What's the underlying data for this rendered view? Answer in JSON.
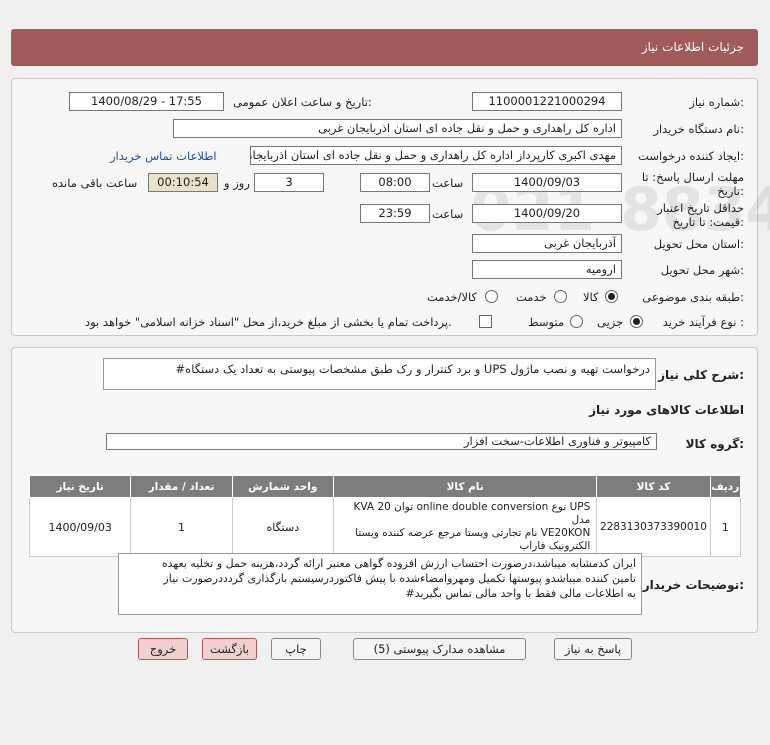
{
  "header": {
    "title": "جزئیات اطلاعات نیاز"
  },
  "form": {
    "need_number_label": "شماره نیاز:",
    "need_number": "1100001221000294",
    "announce_label": "تاریخ و ساعت اعلان عمومی:",
    "announce_value": "1400/08/29 - 17:55",
    "buyer_label": "نام دستگاه خریدار:",
    "buyer_value": "اداره کل راهداری و حمل و نقل جاده ای استان اذربایجان غربی",
    "requester_label": "ایجاد کننده درخواست:",
    "requester_value": "مهدی اکبری کارپرداز اداره کل راهداری و حمل و نقل جاده ای استان اذربایجان غ",
    "contact_link": "اطلاعات تماس خریدار",
    "deadline_label_1": "مهلت ارسال پاسخ: تا",
    "deadline_label_2": "تاریخ:",
    "deadline_date": "1400/09/03",
    "time_label": "ساعت",
    "deadline_time": "08:00",
    "days_value": "3",
    "days_label": "روز و",
    "remaining_time": "00:10:54",
    "remaining_label": "ساعت باقی مانده",
    "validity_label_1": "حداقل تاریخ اعتبار",
    "validity_label_2": "قیمت: تا تاریخ:",
    "validity_date": "1400/09/20",
    "validity_time_label": "ساعت",
    "validity_time": "23:59",
    "province_label": "استان محل تحویل:",
    "province_value": "آذربایجان غربی",
    "city_label": "شهر محل تحویل:",
    "city_value": "ارومیه",
    "category_label": "طبقه بندی موضوعی:",
    "category_options": [
      "کالا",
      "خدمت",
      "کالا/خدمت"
    ],
    "category_selected": "کالا",
    "process_label": "نوع فرآیند خرید :",
    "process_options": [
      "جزیی",
      "متوسط"
    ],
    "process_selected": "جزیی",
    "payment_note": "پرداخت تمام یا بخشی از مبلغ خرید،از محل \"اسناد خزانه اسلامی\" خواهد بود."
  },
  "summary": {
    "label": "شرح کلی نیاز:",
    "value": "درخواست تهیه و نصب ماژول UPS و برد کنترار و رک طبق مشخصات پیوستی به تعداد یک دستگاه#"
  },
  "goods": {
    "section_title": "اطلاعات کالاهای مورد نیاز",
    "group_label": "گروه کالا:",
    "group_value": "کامپیوتر و فناوری اطلاعات-سخت افزار",
    "columns": [
      "ردیف",
      "کد کالا",
      "نام کالا",
      "واحد شمارش",
      "تعداد / مقدار",
      "تاریخ نیاز"
    ],
    "rows": [
      {
        "row": "1",
        "code": "2283130373390010",
        "name_line1": "UPS نوع online double conversion توان 20 KVA مدل",
        "name_line2": "VE20KON نام تجارتی ویستا مرجع عرضه کننده ویستا",
        "name_line3": "الکترونیک فاراب",
        "unit": "دستگاه",
        "qty": "1",
        "date": "1400/09/03"
      }
    ]
  },
  "notes": {
    "label": "توضیحات خریدار:",
    "line1": "ایران کدمشابه میباشد،درصورت احتساب ارزش افزوده گواهی معتبر ارائه گردد،هزینه حمل و تخلیه بعهده",
    "line2": "تامین کننده میباشدو پیوستها تکمیل ومهروامضاءشده با پیش فاکتوردرسیستم بارگذاری گردددرصورت نیاز",
    "line3": "به اطلاعات مالی فقط با واحد مالی تماس بگیرید#"
  },
  "buttons": {
    "reply": "پاسخ به نیاز",
    "attachments": "مشاهده مدارک پیوستی (5)",
    "print": "چاپ",
    "back": "بازگشت",
    "exit": "خروج"
  },
  "watermark": {
    "brand": "ParsNamadData",
    "number": "021-88349670"
  }
}
